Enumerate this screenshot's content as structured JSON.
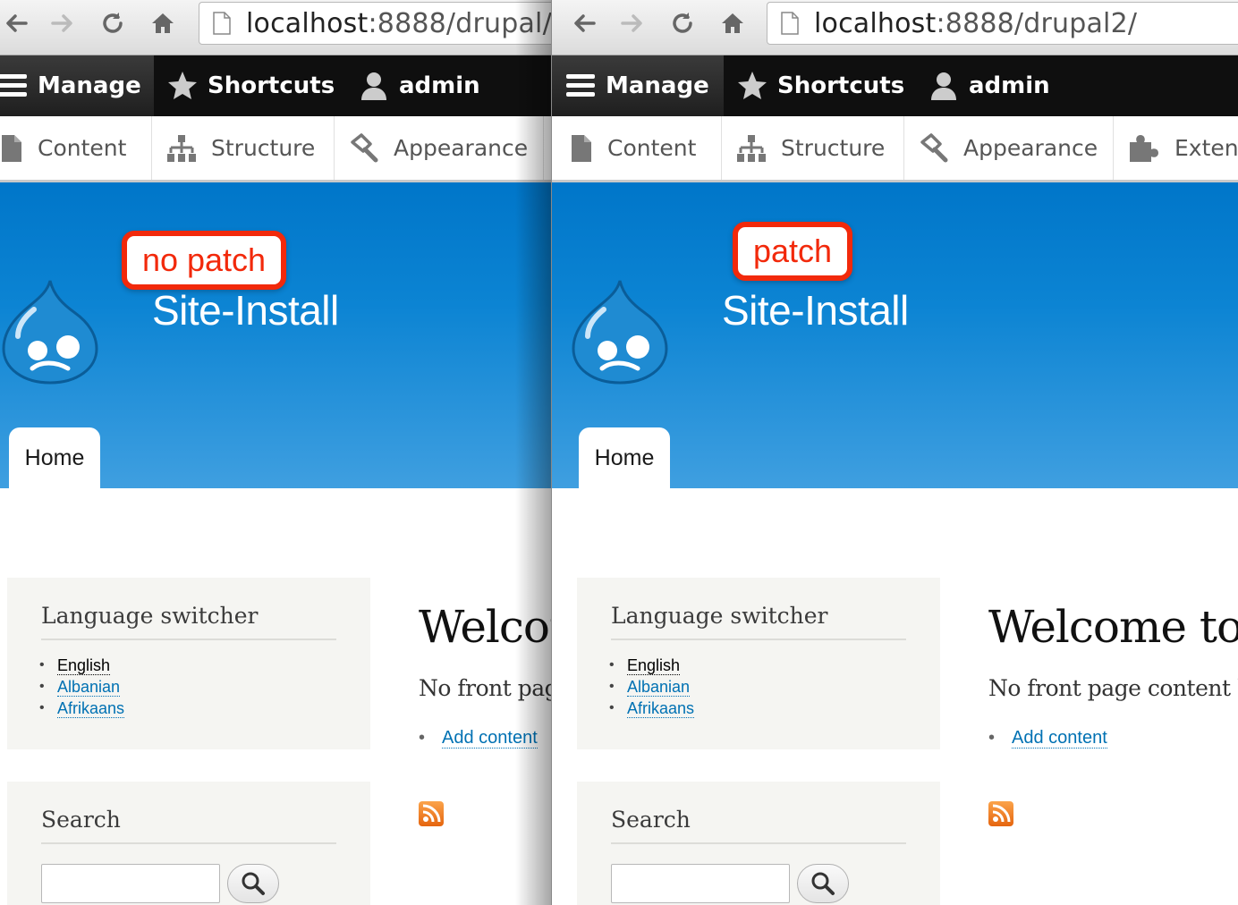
{
  "panes": [
    {
      "id": "left",
      "url_host": "localhost",
      "url_rest": ":8888/drupal/",
      "annotation": "no patch"
    },
    {
      "id": "right",
      "url_host": "localhost",
      "url_rest": ":8888/drupal2/",
      "annotation": "patch"
    }
  ],
  "toolbar": {
    "manage": "Manage",
    "shortcuts": "Shortcuts",
    "user": "admin"
  },
  "tray": {
    "content": "Content",
    "structure": "Structure",
    "appearance": "Appearance",
    "extend": "Extend"
  },
  "site": {
    "name": "Site-Install",
    "home_tab": "Home"
  },
  "language_block": {
    "title": "Language switcher",
    "items": [
      "English",
      "Albanian",
      "Afrikaans"
    ]
  },
  "search_block": {
    "title": "Search"
  },
  "main": {
    "title": "Welcome to Site-Install",
    "text": "No front page content has been created yet.",
    "add_link": "Add content"
  },
  "colors": {
    "header_top": "#0076c9",
    "header_bottom": "#3f9fe0",
    "annotation": "#f2290b",
    "link": "#0071b3"
  }
}
